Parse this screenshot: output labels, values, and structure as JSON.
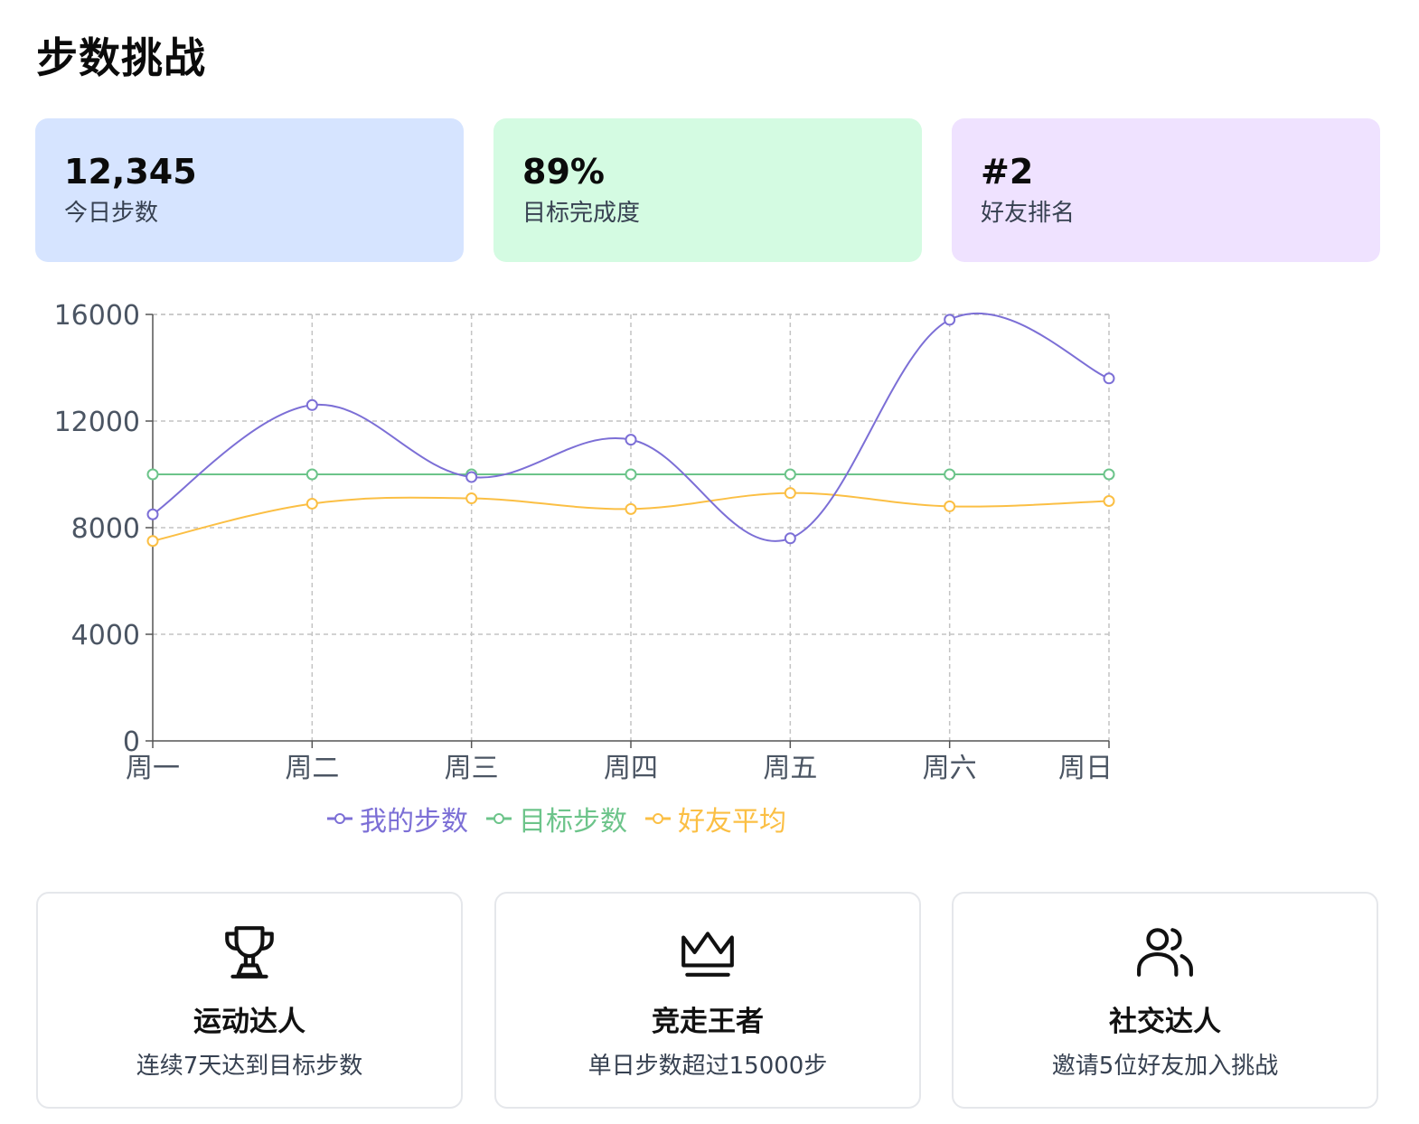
{
  "page": {
    "title": "步数挑战"
  },
  "stats": [
    {
      "value": "12,345",
      "label": "今日步数",
      "bg": "#d6e4ff"
    },
    {
      "value": "89%",
      "label": "目标完成度",
      "bg": "#d4fbe2"
    },
    {
      "value": "#2",
      "label": "好友排名",
      "bg": "#efe2ff"
    }
  ],
  "chart_data": {
    "type": "line",
    "categories": [
      "周一",
      "周二",
      "周三",
      "周四",
      "周五",
      "周六",
      "周日"
    ],
    "y_ticks": [
      0,
      4000,
      8000,
      12000,
      16000
    ],
    "ylim": [
      0,
      16000
    ],
    "grid": true,
    "legend_position": "bottom",
    "series": [
      {
        "name": "我的步数",
        "color": "#7c6fd6",
        "values": [
          8500,
          12600,
          9900,
          11300,
          7600,
          15800,
          13600
        ]
      },
      {
        "name": "目标步数",
        "color": "#6cc48a",
        "values": [
          10000,
          10000,
          10000,
          10000,
          10000,
          10000,
          10000
        ]
      },
      {
        "name": "好友平均",
        "color": "#fbbf44",
        "values": [
          7500,
          8900,
          9100,
          8700,
          9300,
          8800,
          9000
        ]
      }
    ]
  },
  "badges": [
    {
      "icon": "trophy-icon",
      "title": "运动达人",
      "desc": "连续7天达到目标步数"
    },
    {
      "icon": "crown-icon",
      "title": "竞走王者",
      "desc": "单日步数超过15000步"
    },
    {
      "icon": "users-icon",
      "title": "社交达人",
      "desc": "邀请5位好友加入挑战"
    }
  ]
}
